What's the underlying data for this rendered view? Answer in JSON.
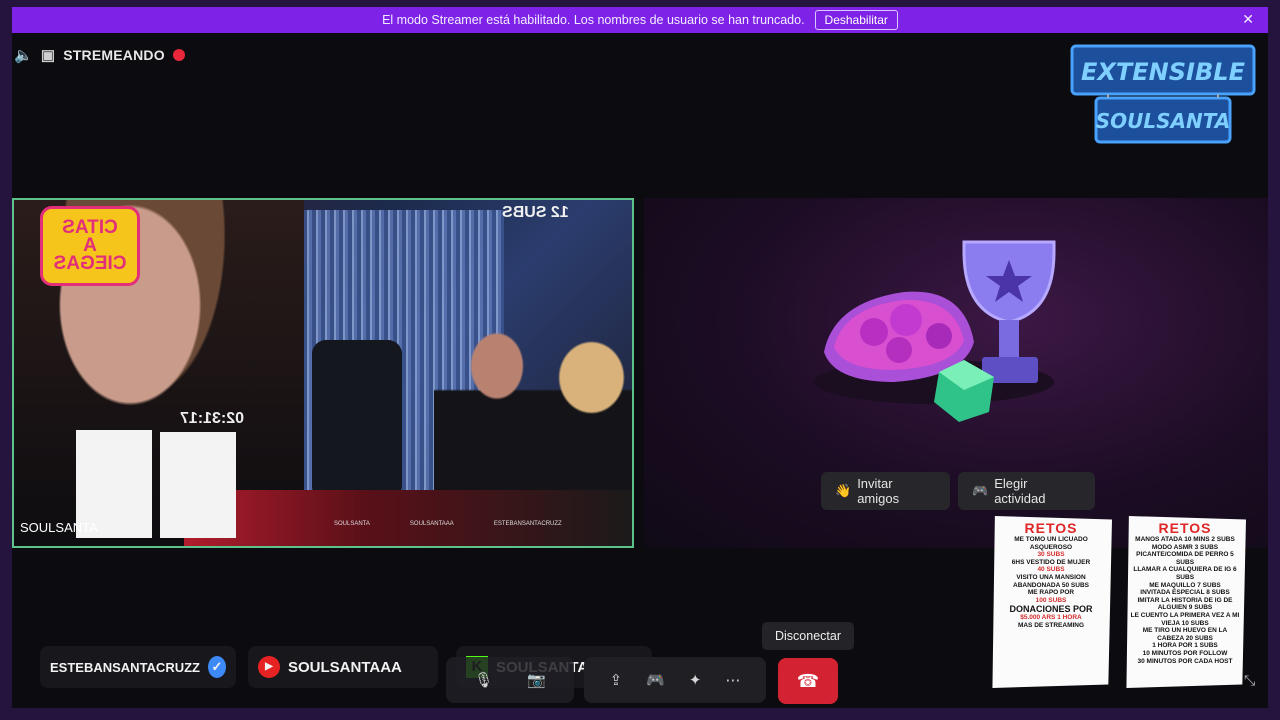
{
  "banner": {
    "message": "El modo Streamer está habilitado. Los nombres de usuario se han truncado.",
    "disable_label": "Deshabilitar",
    "close_icon": "close-icon"
  },
  "top": {
    "status_label": "STREMEANDO",
    "volume_icon": "volume-icon"
  },
  "logo": {
    "line1": "EXTENSIBLE",
    "line2": "SOULSANTA"
  },
  "stream_tile": {
    "overlay_title_lines": [
      "CITAS",
      "A",
      "CIEGAS"
    ],
    "subs_counter": "12 SUBS",
    "timer": "02:31:17",
    "username": "SOULSANTA",
    "mini_handles": [
      "SOULSANTA",
      "SOULSANTAAA",
      "ESTEBANSANTACRUZZ"
    ]
  },
  "activity": {
    "invite_label": "Invitar amigos",
    "choose_label": "Elegir actividad"
  },
  "retos_cards": [
    {
      "title": "RETOS",
      "lines": [
        "ME TOMO UN LICUADO ASQUEROSO",
        "30 SUBS",
        "6HS VESTIDO DE MUJER",
        "40 SUBS",
        "VISITO UNA MANSION ABANDONADA 50 SUBS",
        "ME RAPO POR",
        "100 SUBS",
        "DONACIONES POR",
        "$5.000 ARS 1 HORA",
        "MAS DE STREAMING"
      ]
    },
    {
      "title": "RETOS",
      "lines": [
        "MANOS ATADA 10 MINS 2 SUBS",
        "MODO ASMR 3 SUBS",
        "PICANTE/COMIDA DE PERRO 5 SUBS",
        "LLAMAR A CUALQUIERA DE IG 6 SUBS",
        "ME MAQUILLO 7 SUBS",
        "INVITADA ESPECIAL 8 SUBS",
        "IMITAR LA HISTORIA DE IG DE ALGUIEN 9 SUBS",
        "LE CUENTO LA PRIMERA VEZ A MI VIEJA 10 SUBS",
        "ME TIRO UN HUEVO EN LA CABEZA 20 SUBS",
        "1 HORA POR 1 SUBS",
        "10 MINUTOS POR FOLLOW",
        "30 MINUTOS POR CADA HOST"
      ]
    }
  ],
  "socials": [
    {
      "handle": "ESTEBANSANTACRUZZ",
      "icon": "verified-badge-icon"
    },
    {
      "handle": "SOULSANTAAA",
      "icon": "youtube-icon"
    },
    {
      "handle": "SOULSANTA",
      "icon": "kick-icon"
    }
  ],
  "controls": {
    "disconnect_tooltip": "Disconectar",
    "icons": [
      "microphone-icon",
      "camera-icon",
      "screen-share-icon",
      "gamepad-icon",
      "soundboard-icon",
      "more-icon",
      "hang-up-icon"
    ]
  },
  "colors": {
    "banner": "#7e22e8",
    "hangup": "#d32232",
    "frame": "#24143e",
    "accent_green": "#5ec38a"
  }
}
